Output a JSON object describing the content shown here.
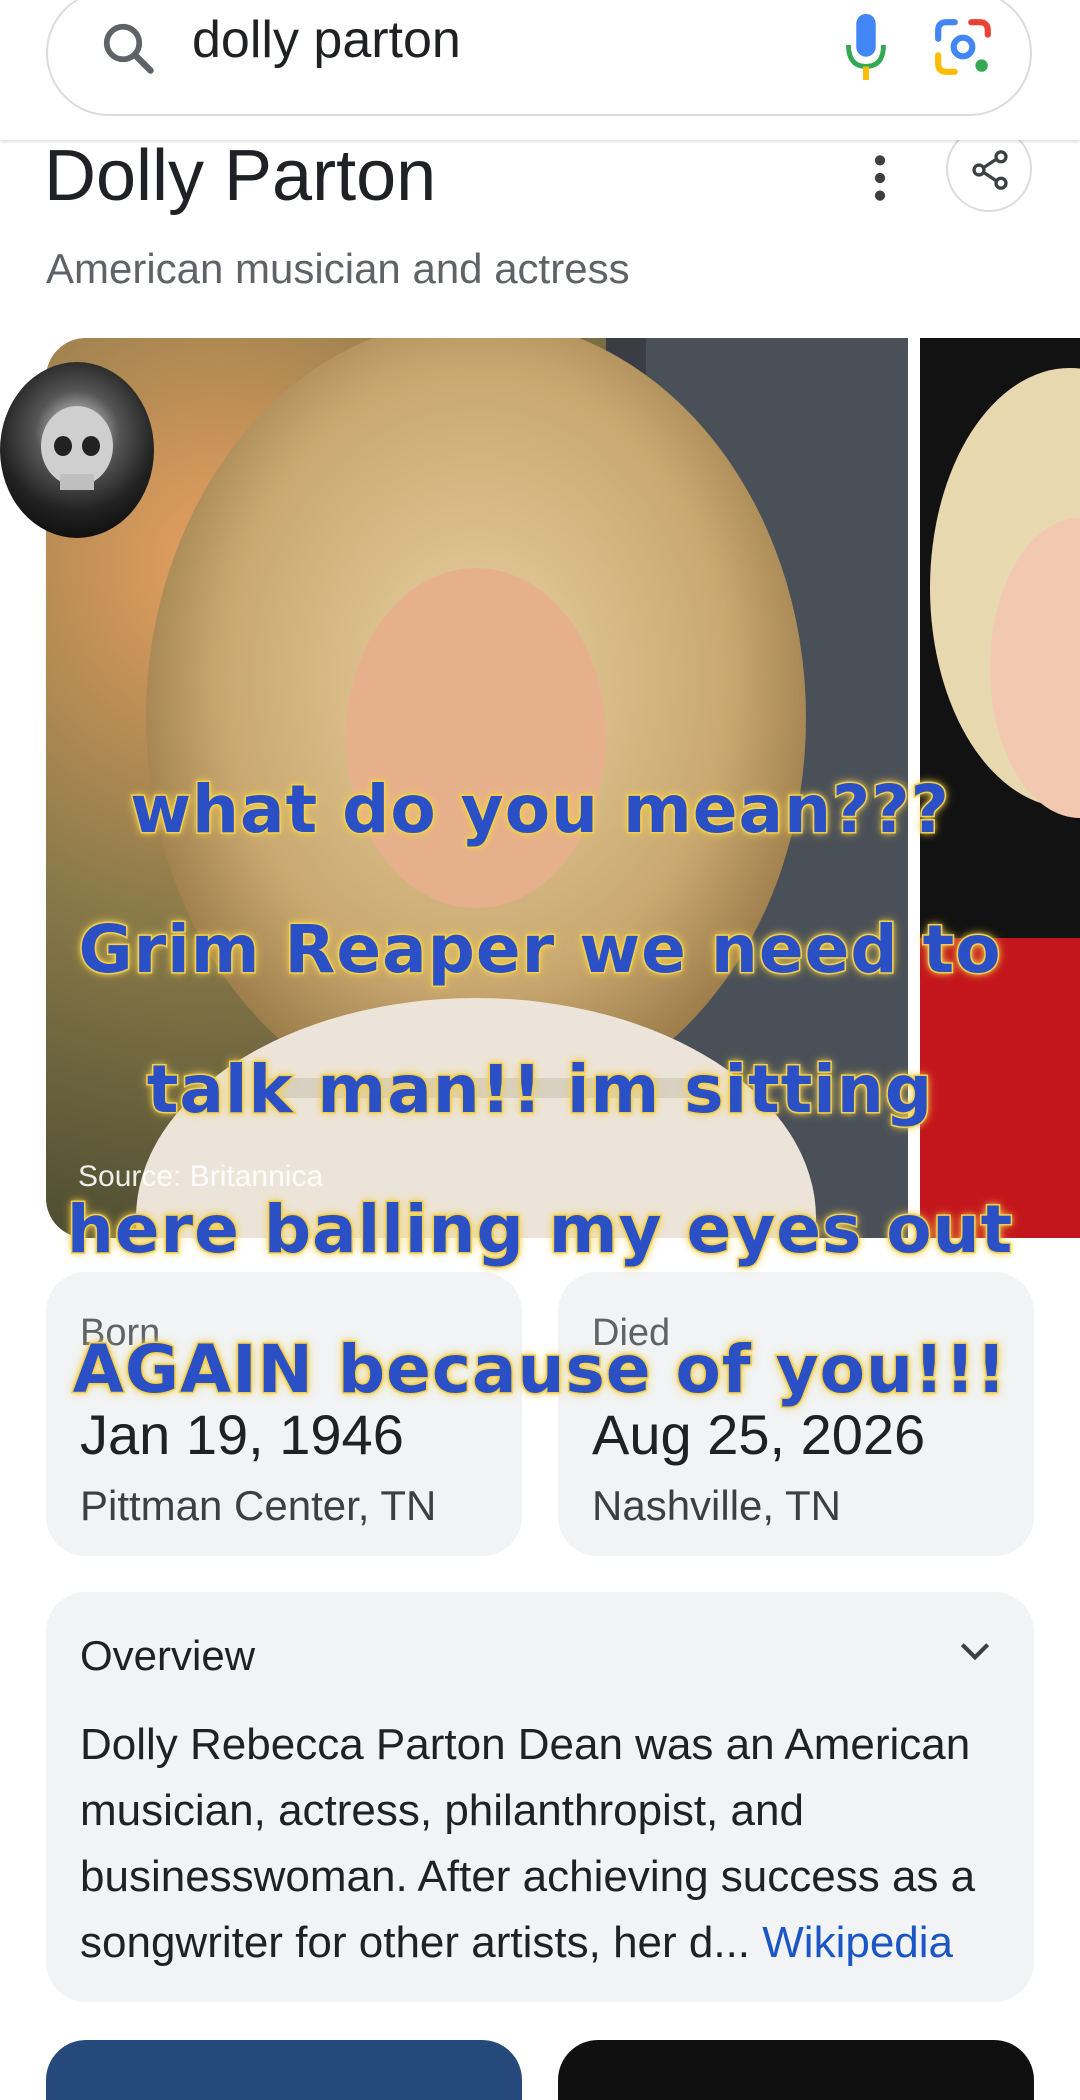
{
  "search": {
    "query": "dolly parton"
  },
  "entity": {
    "title": "Dolly Parton",
    "subtitle": "American musician and actress"
  },
  "image": {
    "source": "Source: Britannica"
  },
  "caption": {
    "lines": [
      "what do you mean???",
      "Grim Reaper we need to",
      "talk man!! im sitting",
      "here balling my eyes out",
      "AGAIN because of you!!!"
    ]
  },
  "born": {
    "label": "Born",
    "date": "Jan 19, 1946",
    "place": "Pittman Center, TN"
  },
  "died": {
    "label": "Died",
    "date": "Aug 25, 2026",
    "place": "Nashville, TN"
  },
  "overview": {
    "heading": "Overview",
    "text": "Dolly Rebecca Parton Dean was an American musician, actress, philanthropist, and businesswoman. After achieving success as a songwriter for other artists, her d...",
    "link": "Wikipedia"
  },
  "colors": {
    "accent_blue": "#1a56c4",
    "caption_fill": "#2b4fc4",
    "caption_outline": "#f2cf4d"
  }
}
